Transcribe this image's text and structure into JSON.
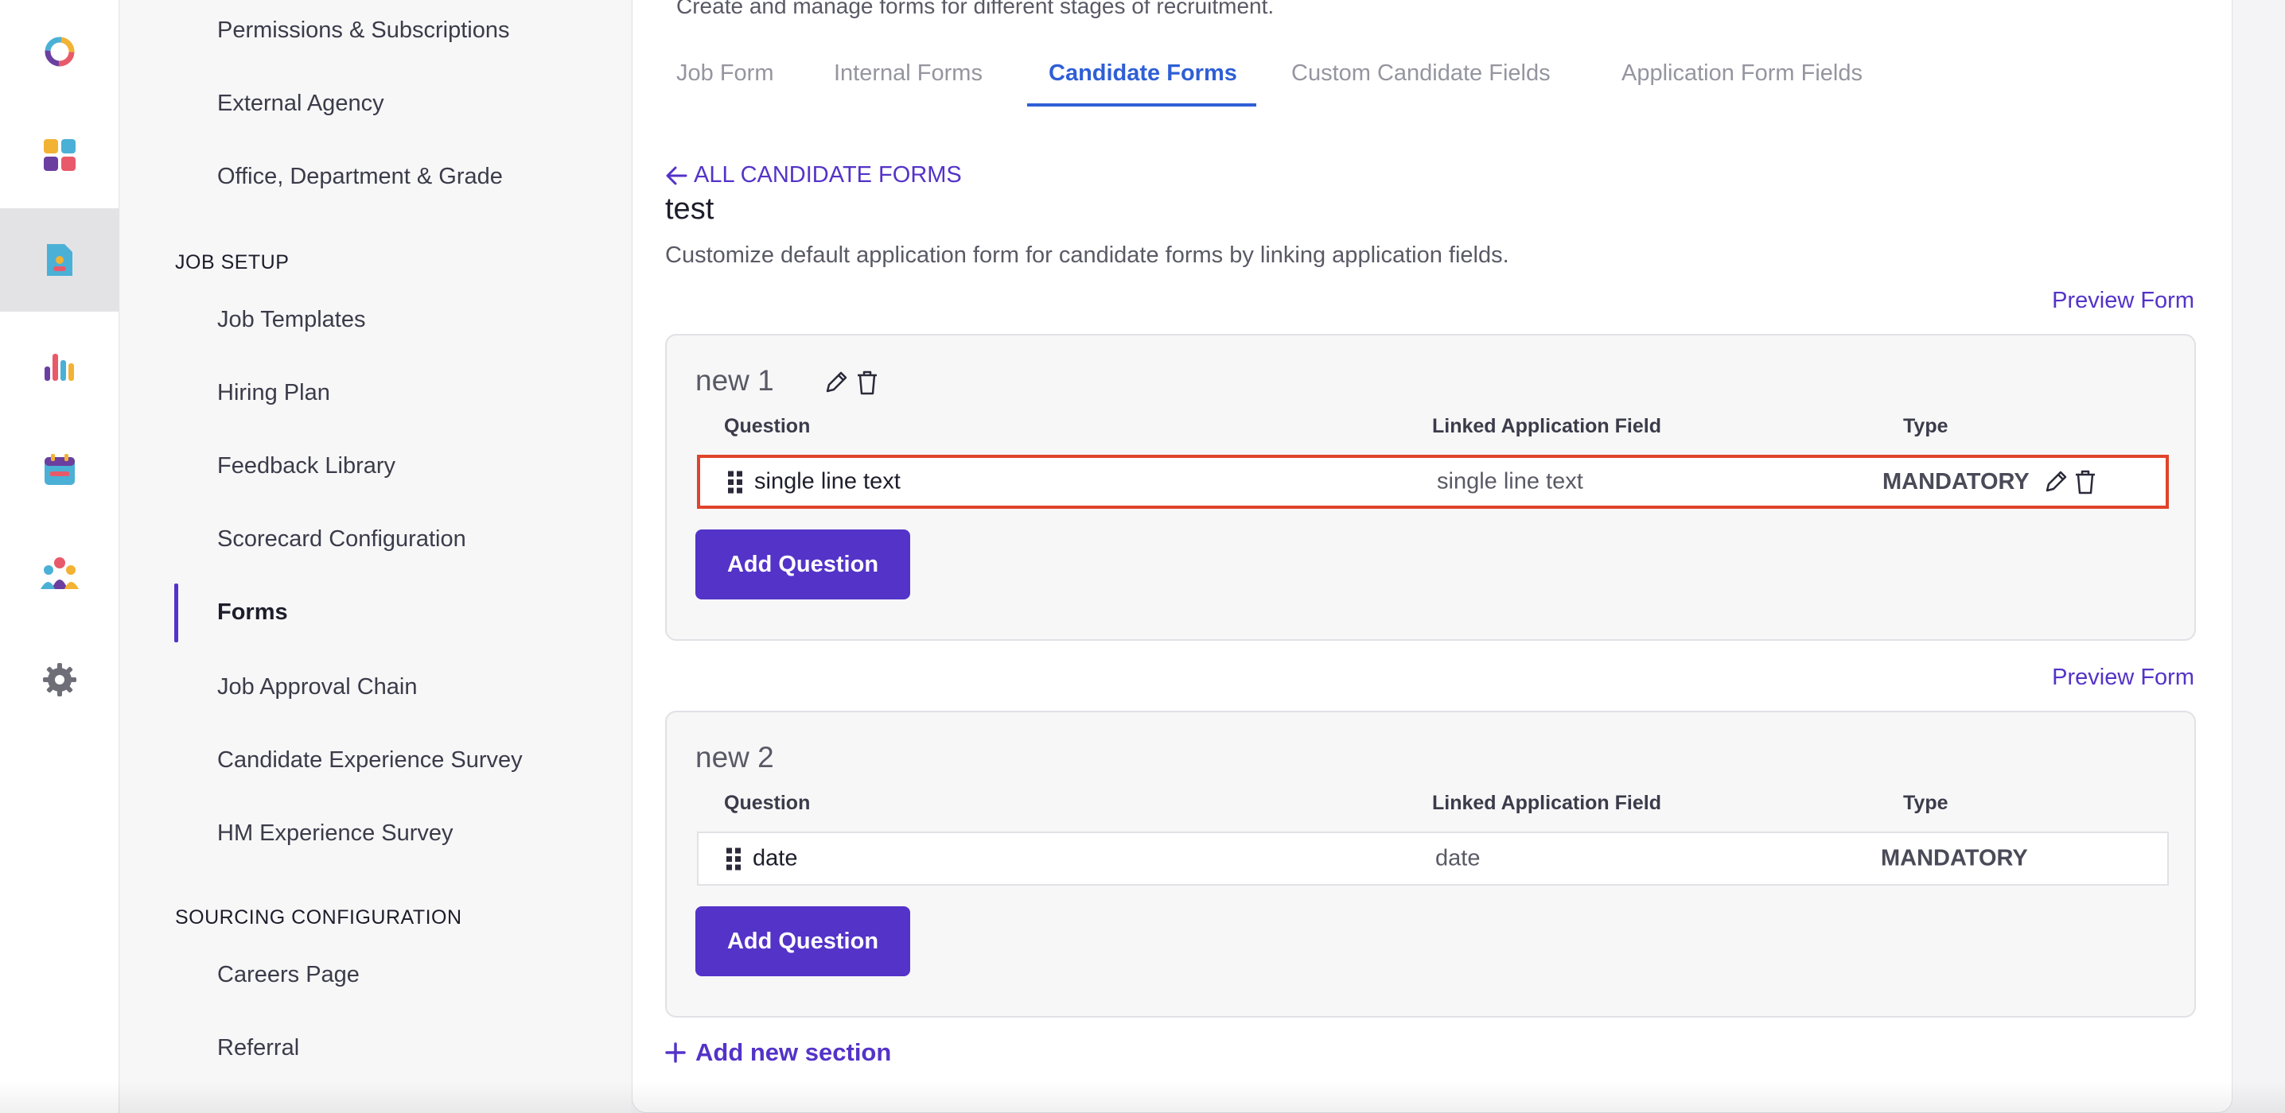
{
  "sidebar": {
    "items_top": [
      "Permissions & Subscriptions",
      "External Agency",
      "Office, Department & Grade"
    ],
    "job_setup_header": "JOB SETUP",
    "job_setup_items": [
      "Job Templates",
      "Hiring Plan",
      "Feedback Library",
      "Scorecard Configuration",
      "Forms",
      "Job Approval Chain",
      "Candidate Experience Survey",
      "HM Experience Survey"
    ],
    "active_item": "Forms",
    "sourcing_header": "SOURCING CONFIGURATION",
    "sourcing_items": [
      "Careers Page",
      "Referral"
    ]
  },
  "main": {
    "page_subtitle": "Create and manage forms for different stages of recruitment.",
    "tabs": [
      "Job Form",
      "Internal Forms",
      "Candidate Forms",
      "Custom Candidate Fields",
      "Application Form Fields"
    ],
    "active_tab": "Candidate Forms",
    "back_link": "ALL CANDIDATE FORMS",
    "form_title": "test",
    "form_description": "Customize default application form for candidate forms by linking application fields.",
    "preview_label": "Preview Form",
    "columns": {
      "question": "Question",
      "linked": "Linked Application Field",
      "type": "Type"
    },
    "add_question_label": "Add Question",
    "add_section_label": "Add new section",
    "sections": [
      {
        "name": "new 1",
        "rows": [
          {
            "question": "single line text",
            "linked_field": "single line text",
            "type": "MANDATORY"
          }
        ]
      },
      {
        "name": "new 2",
        "rows": [
          {
            "question": "date",
            "linked_field": "date",
            "type": "MANDATORY"
          }
        ]
      }
    ]
  },
  "colors": {
    "accent": "#5433c8",
    "tab_active": "#2f5fd6",
    "highlight": "#e0442a"
  }
}
